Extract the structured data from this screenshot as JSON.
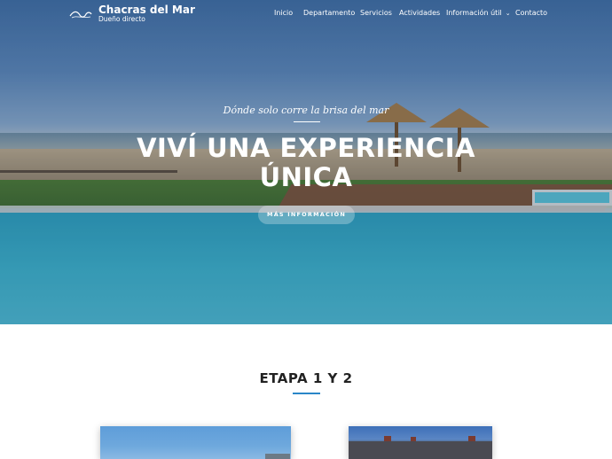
{
  "brand": {
    "name": "Chacras del Mar",
    "tagline": "Dueño directo"
  },
  "nav": {
    "items": [
      {
        "label": "Inicio"
      },
      {
        "label": "Departamento"
      },
      {
        "label": "Servicios"
      },
      {
        "label": "Actividades"
      },
      {
        "label": "Información útil",
        "has_dropdown": true
      },
      {
        "label": "Contacto"
      }
    ],
    "dropdown_icon": "chevron-down-icon"
  },
  "hero": {
    "tagline": "Dónde solo corre la brisa del mar",
    "headline_line1": "VIVÍ UNA EXPERIENCIA",
    "headline_line2": "ÚNICA",
    "cta_label": "MÁS INFORMACIÓN"
  },
  "section": {
    "title": "ETAPA 1 Y 2"
  },
  "colors": {
    "accent": "#2a86c8",
    "heading": "#222222",
    "hero_text": "#ffffff"
  }
}
